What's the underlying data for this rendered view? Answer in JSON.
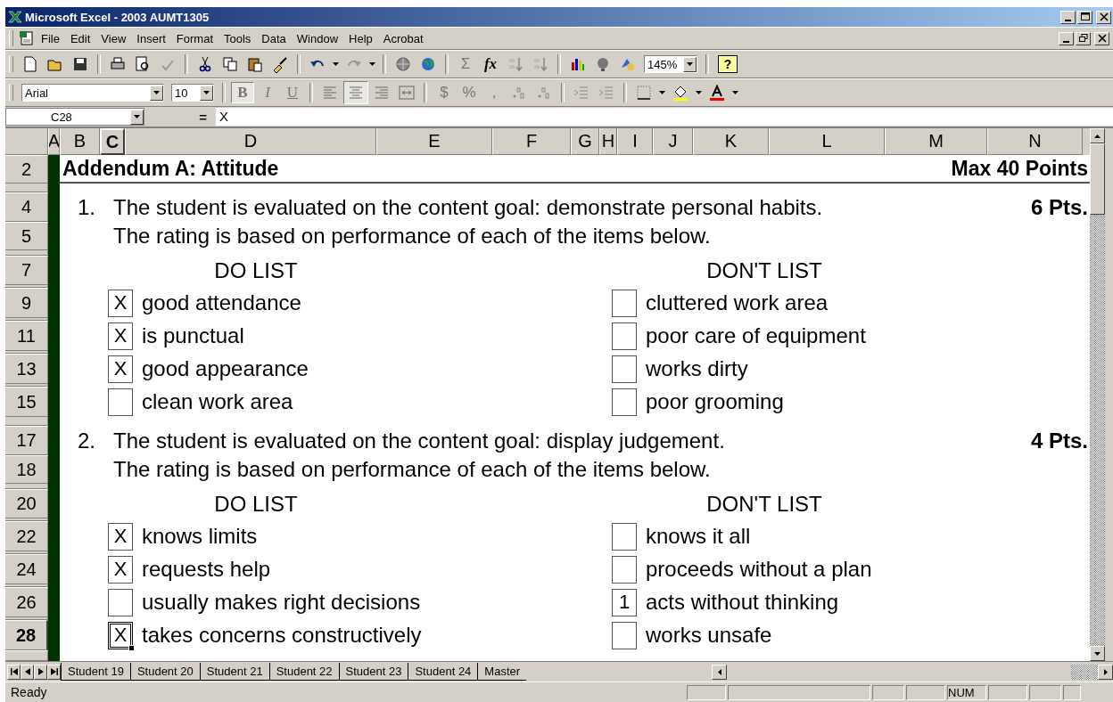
{
  "window": {
    "title": "Microsoft Excel - 2003 AUMT1305"
  },
  "menu": [
    "File",
    "Edit",
    "View",
    "Insert",
    "Format",
    "Tools",
    "Data",
    "Window",
    "Help",
    "Acrobat"
  ],
  "standard_toolbar": {
    "sum": "Σ",
    "function": "fx",
    "zoom": "145%",
    "help": "?"
  },
  "formatting_toolbar": {
    "font": "Arial",
    "size": "10",
    "bold": "B",
    "italic": "I",
    "underline": "U",
    "currency": "$",
    "percent": "%",
    "comma": ",",
    "bold_pressed": true,
    "center_align_pressed": true
  },
  "formula_bar": {
    "cell": "C28",
    "equals": "=",
    "value": "X"
  },
  "columns": [
    {
      "label": "A",
      "selected": false
    },
    {
      "label": "B",
      "selected": false
    },
    {
      "label": "C",
      "selected": true
    },
    {
      "label": "D",
      "selected": false
    },
    {
      "label": "E",
      "selected": false
    },
    {
      "label": "F",
      "selected": false
    },
    {
      "label": "G",
      "selected": false
    },
    {
      "label": "H",
      "selected": false
    },
    {
      "label": "I",
      "selected": false
    },
    {
      "label": "J",
      "selected": false
    },
    {
      "label": "K",
      "selected": false
    },
    {
      "label": "L",
      "selected": false
    },
    {
      "label": "M",
      "selected": false
    },
    {
      "label": "N",
      "selected": false
    }
  ],
  "rows": [
    {
      "number": "2",
      "kind": "title",
      "selected": false,
      "text": "Addendum A: Attitude",
      "points": "Max 40 Points"
    },
    {
      "number": "4",
      "kind": "question",
      "selected": false,
      "index": "1.",
      "text": "The student is evaluated on the content goal: demonstrate personal habits.",
      "points": "6 Pts."
    },
    {
      "number": "5",
      "kind": "note",
      "selected": false,
      "text": "The rating is based on performance of each of the items below."
    },
    {
      "number": "7",
      "kind": "heads",
      "selected": false,
      "left": "DO LIST",
      "right": "DON'T LIST"
    },
    {
      "number": "9",
      "kind": "pair",
      "selected": false,
      "left": {
        "mark": "X",
        "label": "good attendance"
      },
      "right": {
        "label": "cluttered work area"
      }
    },
    {
      "number": "11",
      "kind": "pair",
      "selected": false,
      "left": {
        "mark": "X",
        "label": "is punctual"
      },
      "right": {
        "label": "poor care of equipment"
      }
    },
    {
      "number": "13",
      "kind": "pair",
      "selected": false,
      "left": {
        "mark": "X",
        "label": "good appearance"
      },
      "right": {
        "label": "works dirty"
      }
    },
    {
      "number": "15",
      "kind": "pair",
      "selected": false,
      "left": {
        "label": "clean work area"
      },
      "right": {
        "label": "poor grooming"
      }
    },
    {
      "number": "17",
      "kind": "question",
      "selected": false,
      "index": "2.",
      "text": "The student is evaluated on the content goal: display judgement.",
      "points": "4 Pts."
    },
    {
      "number": "18",
      "kind": "note",
      "selected": false,
      "text": "The rating is based on performance of each of the items below."
    },
    {
      "number": "20",
      "kind": "heads",
      "selected": false,
      "left": "DO LIST",
      "right": "DON'T LIST"
    },
    {
      "number": "22",
      "kind": "pair",
      "selected": false,
      "left": {
        "mark": "X",
        "label": "knows limits"
      },
      "right": {
        "label": "knows it all"
      }
    },
    {
      "number": "24",
      "kind": "pair",
      "selected": false,
      "left": {
        "mark": "X",
        "label": "requests help"
      },
      "right": {
        "label": "proceeds without a plan"
      }
    },
    {
      "number": "26",
      "kind": "pair",
      "selected": false,
      "left": {
        "label": "usually makes right decisions"
      },
      "right": {
        "mark": "1",
        "label": "acts without thinking"
      }
    },
    {
      "number": "28",
      "kind": "pair",
      "selected": true,
      "left": {
        "mark": "X",
        "label": "takes concerns constructively"
      },
      "right": {
        "label": "works unsafe"
      }
    }
  ],
  "sheet_tabs": [
    {
      "label": "Student 19",
      "selected": false
    },
    {
      "label": "Student 20",
      "selected": false
    },
    {
      "label": "Student 21",
      "selected": false
    },
    {
      "label": "Student 22",
      "selected": false
    },
    {
      "label": "Student 23",
      "selected": false
    },
    {
      "label": "Student 24",
      "selected": false
    },
    {
      "label": "Master",
      "selected": false
    }
  ],
  "status_bar": {
    "mode": "Ready",
    "indicator": "NUM"
  }
}
